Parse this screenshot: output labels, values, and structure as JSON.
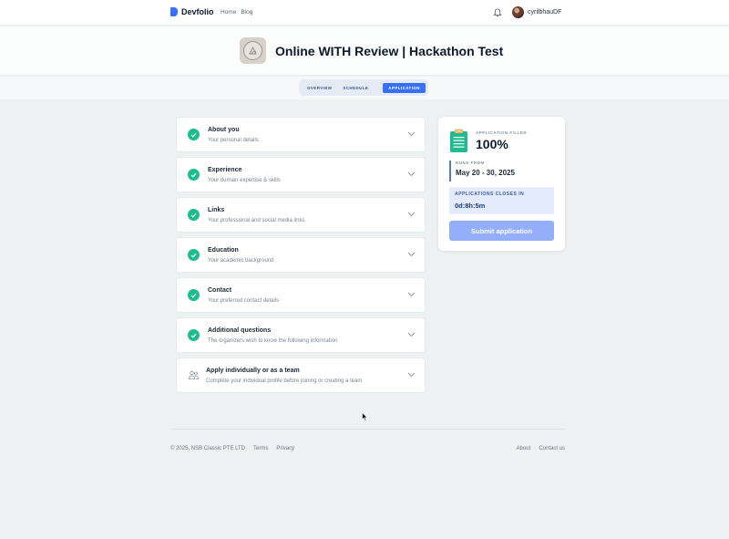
{
  "nav": {
    "brand": "Devfolio",
    "links": [
      "Home",
      "Blog"
    ],
    "username": "cyrilbhauDF"
  },
  "hackathon": {
    "title": "Online WITH Review | Hackathon Test"
  },
  "tabs": [
    "OVERVIEW",
    "SCHEDULE",
    "APPLICATION"
  ],
  "sections": [
    {
      "title": "About you",
      "subtitle": "Your personal details",
      "complete": true
    },
    {
      "title": "Experience",
      "subtitle": "Your domain expertise & skills",
      "complete": true
    },
    {
      "title": "Links",
      "subtitle": "Your professional and social media links",
      "complete": true
    },
    {
      "title": "Education",
      "subtitle": "Your academic background",
      "complete": true
    },
    {
      "title": "Contact",
      "subtitle": "Your preferred contact details",
      "complete": true
    },
    {
      "title": "Additional questions",
      "subtitle": "The organizers wish to know the following information",
      "complete": true
    },
    {
      "title": "Apply individually or as a team",
      "subtitle": "Complete your individual profile before joining or creating a team",
      "complete": false
    }
  ],
  "status": {
    "filled_label": "APPLICATION FILLED",
    "filled_value": "100%",
    "runs_label": "RUNS FROM",
    "runs_value": "May 20 - 30, 2025",
    "closes_label": "APPLICATIONS CLOSES IN",
    "closes_value": "0d:8h:5m",
    "submit_label": "Submit application"
  },
  "footer": {
    "copyright": "© 2025, NSB Classic PTE LTD",
    "left_links": [
      "Terms",
      "Privacy"
    ],
    "right_links": [
      "About",
      "Contact us"
    ]
  },
  "colors": {
    "accent": "#3770ff",
    "success": "#1dbc8c",
    "submit_disabled": "#93aefb"
  }
}
